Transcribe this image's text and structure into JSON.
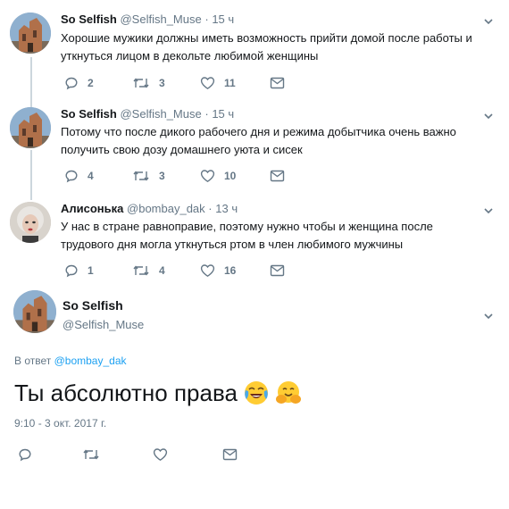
{
  "thread": [
    {
      "name": "So Selfish",
      "handle": "@Selfish_Muse",
      "dot": "·",
      "time": "15 ч",
      "lines": [
        "Хорошие мужики должны иметь возможность прийти домой после работы и",
        "уткнуться лицом в декольте любимой женщины"
      ],
      "replies": "2",
      "retweets": "3",
      "likes": "11"
    },
    {
      "name": "So Selfish",
      "handle": "@Selfish_Muse",
      "dot": "·",
      "time": "15 ч",
      "lines": [
        "Потому что после дикого рабочего дня и режима добытчика очень важно",
        "получить свою дозу домашнего уюта и сисек"
      ],
      "replies": "4",
      "retweets": "3",
      "likes": "10"
    },
    {
      "name": "Алисонька",
      "handle": "@bombay_dak",
      "dot": "·",
      "time": "13 ч",
      "lines": [
        "У нас в стране равноправие, поэтому нужно чтобы и женщина после",
        "трудового дня могла уткнуться ртом в член любимого мужчины"
      ],
      "replies": "1",
      "retweets": "4",
      "likes": "16"
    }
  ],
  "main": {
    "name": "So Selfish",
    "handle": "@Selfish_Muse",
    "reply_prefix": "В ответ ",
    "reply_to": "@bombay_dak",
    "text": "Ты абсолютно права",
    "emojis": [
      "face-with-tears-of-joy-icon",
      "hugging-face-icon"
    ],
    "timestamp": "9:10 - 3 окт. 2017 г."
  },
  "colors": {
    "secondary_text": "#657786",
    "link": "#1da1f2",
    "thread_line": "#ccd6dd"
  }
}
